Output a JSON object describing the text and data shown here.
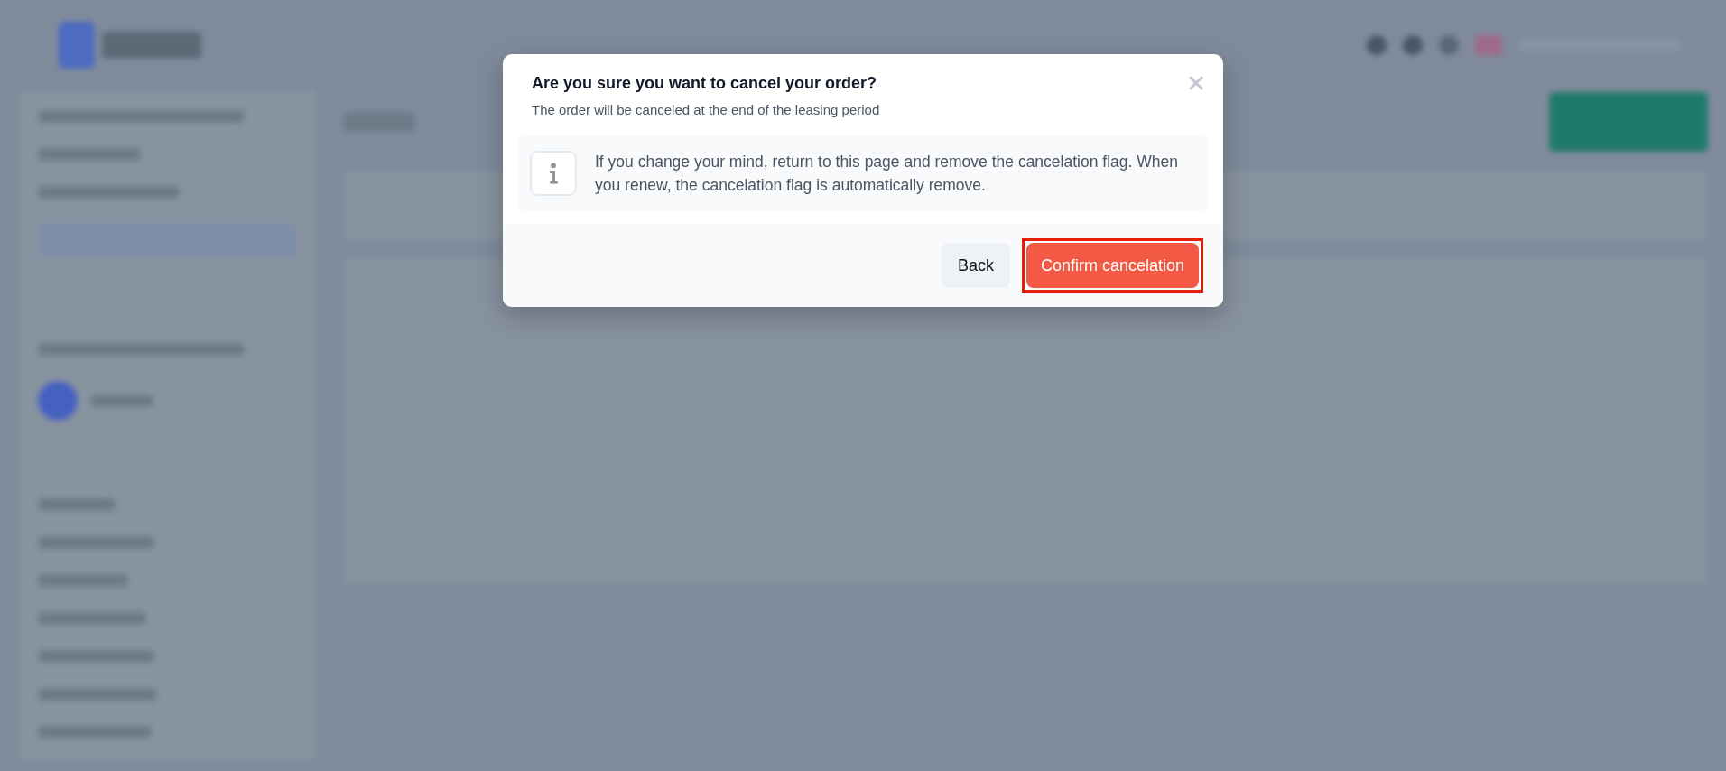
{
  "dialog": {
    "title": "Are you sure you want to cancel your order?",
    "subtitle": "The order will be canceled at the end of the leasing period",
    "notice": "If you change your mind, return to this page and remove the cancelation flag. When you renew, the cancelation flag is automatically remove.",
    "buttons": [
      {
        "label": "Back",
        "kind": "secondary",
        "highlighted": false
      },
      {
        "label": "Confirm cancelation",
        "kind": "danger",
        "highlighted": true
      }
    ]
  }
}
